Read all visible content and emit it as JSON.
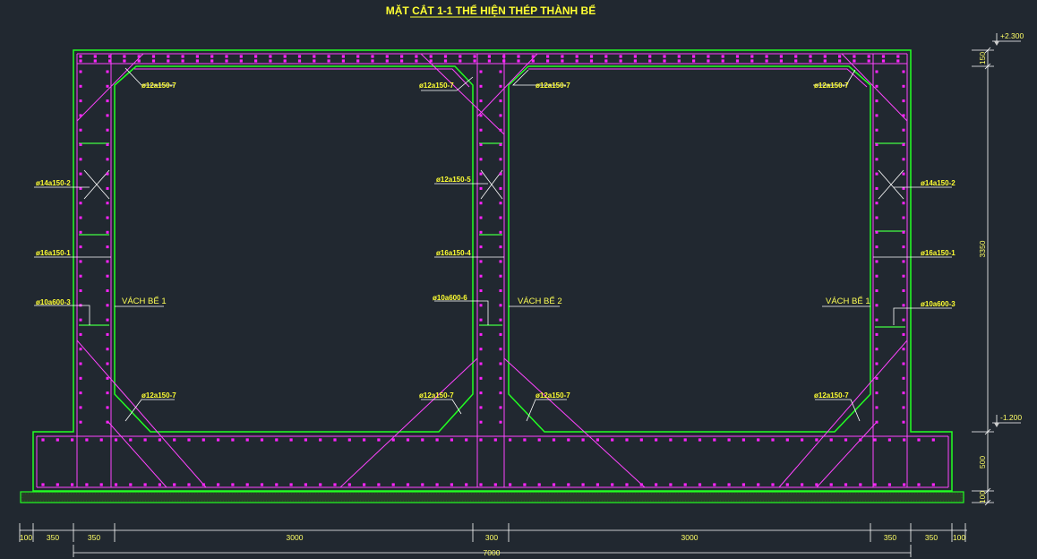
{
  "title": "MẶT CẮT 1-1 THỂ HIỆN THÉP THÀNH BỂ",
  "wall_labels": [
    "VÁCH BỂ 1",
    "VÁCH BỂ 2",
    "VÁCH BỂ 1"
  ],
  "rebar_labels": {
    "top_left_1": "ø12a150-7",
    "top_left_2": "ø12a150-7",
    "top_right_1": "ø12a150-7",
    "top_right_2": "ø12a150-7",
    "bot_left_1": "ø12a150-7",
    "bot_left_2": "ø12a150-7",
    "bot_right_1": "ø12a150-7",
    "bot_right_2": "ø12a150-7",
    "left_a": "ø14a150-2",
    "left_b": "ø16a150-1",
    "left_c": "ø10a600-3",
    "mid_a": "ø12a150-5",
    "mid_b": "ø16a150-4",
    "mid_c": "ø10a600-6",
    "right_a": "ø14a150-2",
    "right_b": "ø16a150-1",
    "right_c": "ø10a600-3"
  },
  "elevations": {
    "top": "+2.300",
    "bottom": "-1.200"
  },
  "vertical_dims": [
    "150",
    "3350",
    "500",
    "100"
  ],
  "horizontal_dims": [
    "100",
    "350",
    "350",
    "3000",
    "300",
    "3000",
    "350",
    "350",
    "100"
  ],
  "total_width": "7000",
  "colors": {
    "background": "#212830",
    "concrete": "#22ff22",
    "rebar": "#ff33ff",
    "dots": "#ff22ff",
    "text": "#ffff33",
    "leader": "#ffffff"
  }
}
